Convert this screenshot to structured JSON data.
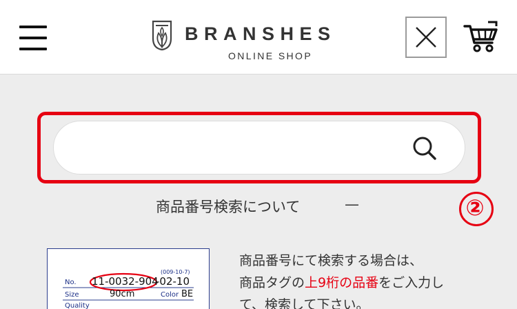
{
  "header": {
    "brand_name": "BRANSHES",
    "brand_sub": "ONLINE SHOP",
    "menu_icon": "hamburger-menu-icon",
    "close_icon": "close-icon",
    "cart_icon": "cart-icon"
  },
  "search": {
    "value": "",
    "placeholder": "",
    "search_icon": "search-icon"
  },
  "about": {
    "label": "商品番号検索について",
    "toggle": "—"
  },
  "step_marker": "②",
  "tag_sample": {
    "date": "(009-10-7)",
    "no_label": "No.",
    "product_number": "11-0032-904",
    "number_suffix": "-02-10",
    "size_label": "Size",
    "size_value": "90cm",
    "color_label": "Color",
    "color_value": "BE",
    "quality_label": "Quality"
  },
  "description": {
    "line1": "商品番号にて検索する場合は、",
    "line2_before": "商品タグの",
    "line2_highlight": "上9桁の品番",
    "line2_after": "をご入力し",
    "line3": "て、検索して下さい。"
  },
  "colors": {
    "accent_red": "#e60012",
    "tag_blue": "#1a2e86",
    "page_bg": "#ededed"
  }
}
